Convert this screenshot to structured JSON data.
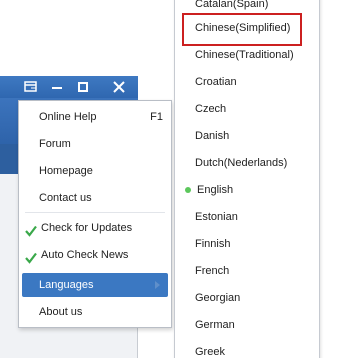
{
  "main_menu": {
    "items": [
      {
        "label": "Online Help",
        "shortcut": "F1"
      },
      {
        "label": "Forum"
      },
      {
        "label": "Homepage"
      },
      {
        "label": "Contact us"
      },
      {
        "label": "Check for Updates",
        "checked": true
      },
      {
        "label": "Auto Check News",
        "checked": true
      },
      {
        "label": "Languages",
        "has_submenu": true,
        "active": true
      },
      {
        "label": "About us"
      }
    ]
  },
  "languages_menu": {
    "items": [
      {
        "label": "Catalan(Spain)"
      },
      {
        "label": "Chinese(Simplified)",
        "highlighted": true
      },
      {
        "label": "Chinese(Traditional)"
      },
      {
        "label": "Croatian"
      },
      {
        "label": "Czech"
      },
      {
        "label": "Danish"
      },
      {
        "label": "Dutch(Nederlands)"
      },
      {
        "label": "English",
        "selected": true
      },
      {
        "label": "Estonian"
      },
      {
        "label": "Finnish"
      },
      {
        "label": "French"
      },
      {
        "label": "Georgian"
      },
      {
        "label": "German"
      },
      {
        "label": "Greek"
      }
    ]
  },
  "colors": {
    "menu_active_bg": "#3b78c2",
    "check_green": "#3aa84a",
    "selected_dot": "#5cc75c",
    "highlight_border": "#cc2020",
    "titlebar_blue": "#3e79c2"
  },
  "icons": {
    "titlebar": [
      "menu-icon",
      "minimize-icon",
      "maximize-icon",
      "close-icon"
    ],
    "check": "checkmark-icon",
    "submenu": "chevron-right-icon",
    "selection": "radio-dot-icon"
  }
}
